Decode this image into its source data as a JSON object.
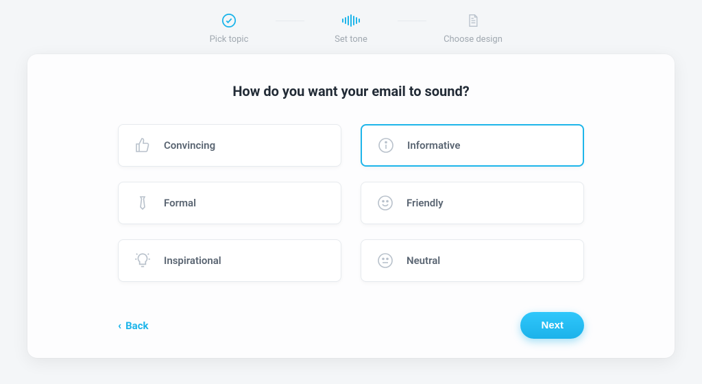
{
  "stepper": {
    "steps": [
      {
        "label": "Pick topic",
        "icon": "check-circle",
        "state": "done"
      },
      {
        "label": "Set tone",
        "icon": "waveform",
        "state": "active"
      },
      {
        "label": "Choose design",
        "icon": "document",
        "state": "pending"
      }
    ]
  },
  "card": {
    "title": "How do you want your email to sound?"
  },
  "options": [
    {
      "key": "convincing",
      "label": "Convincing",
      "icon": "thumbs-up",
      "selected": false
    },
    {
      "key": "informative",
      "label": "Informative",
      "icon": "info",
      "selected": true
    },
    {
      "key": "formal",
      "label": "Formal",
      "icon": "tie",
      "selected": false
    },
    {
      "key": "friendly",
      "label": "Friendly",
      "icon": "smile",
      "selected": false
    },
    {
      "key": "inspirational",
      "label": "Inspirational",
      "icon": "lightbulb",
      "selected": false
    },
    {
      "key": "neutral",
      "label": "Neutral",
      "icon": "neutral-face",
      "selected": false
    }
  ],
  "footer": {
    "back_label": "Back",
    "next_label": "Next"
  },
  "colors": {
    "accent": "#1DB5EA"
  }
}
